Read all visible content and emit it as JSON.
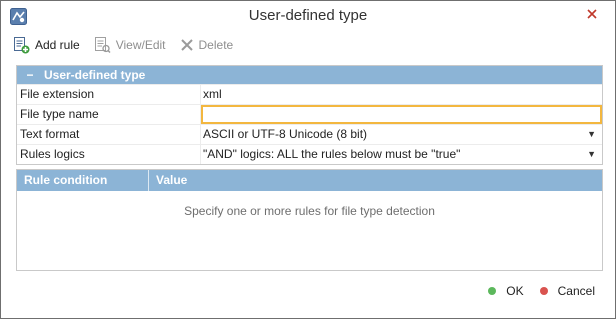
{
  "window": {
    "title": "User-defined type",
    "icon": "app-icon",
    "close_icon": "close-icon"
  },
  "toolbar": {
    "add_rule": {
      "label": "Add rule",
      "icon": "add-rule-icon",
      "enabled": true
    },
    "view_edit": {
      "label": "View/Edit",
      "icon": "view-edit-icon",
      "enabled": false
    },
    "delete": {
      "label": "Delete",
      "icon": "delete-icon",
      "enabled": false
    }
  },
  "properties": {
    "group_collapse_symbol": "−",
    "group_title": "User-defined type",
    "rows": [
      {
        "name": "File extension",
        "value": "xml",
        "type": "text"
      },
      {
        "name": "File type name",
        "value": "",
        "type": "input"
      },
      {
        "name": "Text format",
        "value": "ASCII or UTF-8 Unicode (8 bit)",
        "type": "dropdown"
      },
      {
        "name": "Rules logics",
        "value": "\"AND\" logics: ALL the rules below must be \"true\"",
        "type": "dropdown"
      }
    ]
  },
  "rules": {
    "columns": [
      "Rule condition",
      "Value"
    ],
    "empty_message": "Specify one or more rules for file type detection"
  },
  "footer": {
    "ok_label": "OK",
    "cancel_label": "Cancel",
    "ok_color": "#5cb85c",
    "cancel_color": "#d9534f"
  },
  "colors": {
    "header_bg": "#8cb4d6",
    "input_focus_border": "#f3b73f"
  }
}
